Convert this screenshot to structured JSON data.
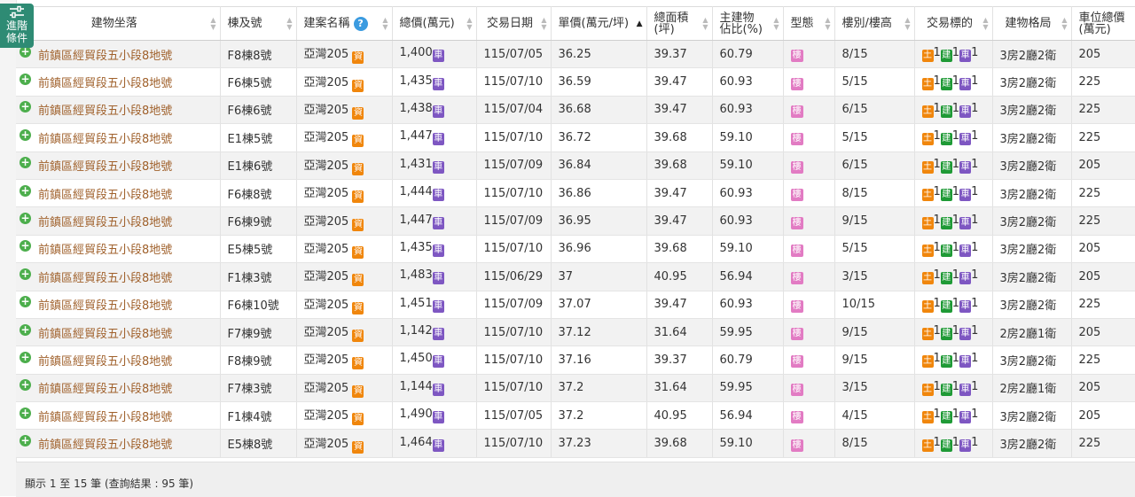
{
  "advanced_filter": {
    "label_line1": "進階",
    "label_line2": "條件",
    "icon": "sliders-icon"
  },
  "columns": [
    {
      "key": "address",
      "label": "建物坐落",
      "sort": "none"
    },
    {
      "key": "unit",
      "label": "棟及號",
      "sort": "none"
    },
    {
      "key": "project",
      "label": "建案名稱",
      "sort": "none",
      "help": "?"
    },
    {
      "key": "total_price",
      "label": "總價(萬元)",
      "sort": "none"
    },
    {
      "key": "date",
      "label": "交易日期",
      "sort": "none"
    },
    {
      "key": "unit_price",
      "label": "單價(萬元/坪)",
      "sort": "asc"
    },
    {
      "key": "area",
      "label_line1": "總面積",
      "label_line2": "(坪)",
      "sort": "none"
    },
    {
      "key": "main_ratio",
      "label_line1": "主建物",
      "label_line2": "佔比(%)",
      "sort": "none"
    },
    {
      "key": "type",
      "label": "型態",
      "sort": "none"
    },
    {
      "key": "floor",
      "label": "樓別/樓高",
      "sort": "none"
    },
    {
      "key": "target",
      "label": "交易標的",
      "sort": "none"
    },
    {
      "key": "layout",
      "label": "建物格局",
      "sort": "none"
    },
    {
      "key": "parking",
      "label_line1": "車位總價",
      "label_line2": "(萬元)",
      "sort": "none"
    }
  ],
  "badges": {
    "project": "資",
    "car": "車",
    "type": "樓",
    "land": "土",
    "build": "建"
  },
  "colors": {
    "address_text": "#a0612c",
    "badge_orange": "#f0860c",
    "badge_purple": "#7e57c2",
    "badge_green": "#1f9a36",
    "badge_pink": "#e27bc3",
    "accent_green": "#2e8b74"
  },
  "rows": [
    {
      "address": "前鎮區經貿段五小段8地號",
      "unit": "F8棟8號",
      "project": "亞灣205",
      "total_price": "1,400",
      "date": "115/07/05",
      "unit_price": "36.25",
      "area": "39.37",
      "main_ratio": "60.79",
      "floor": "8/15",
      "land": "1",
      "build": "1",
      "car": "1",
      "layout": "3房2廳2衛",
      "parking": "205"
    },
    {
      "address": "前鎮區經貿段五小段8地號",
      "unit": "F6棟5號",
      "project": "亞灣205",
      "total_price": "1,435",
      "date": "115/07/10",
      "unit_price": "36.59",
      "area": "39.47",
      "main_ratio": "60.93",
      "floor": "5/15",
      "land": "1",
      "build": "1",
      "car": "1",
      "layout": "3房2廳2衛",
      "parking": "225"
    },
    {
      "address": "前鎮區經貿段五小段8地號",
      "unit": "F6棟6號",
      "project": "亞灣205",
      "total_price": "1,438",
      "date": "115/07/04",
      "unit_price": "36.68",
      "area": "39.47",
      "main_ratio": "60.93",
      "floor": "6/15",
      "land": "1",
      "build": "1",
      "car": "1",
      "layout": "3房2廳2衛",
      "parking": "225"
    },
    {
      "address": "前鎮區經貿段五小段8地號",
      "unit": "E1棟5號",
      "project": "亞灣205",
      "total_price": "1,447",
      "date": "115/07/10",
      "unit_price": "36.72",
      "area": "39.68",
      "main_ratio": "59.10",
      "floor": "5/15",
      "land": "1",
      "build": "1",
      "car": "1",
      "layout": "3房2廳2衛",
      "parking": "225"
    },
    {
      "address": "前鎮區經貿段五小段8地號",
      "unit": "E1棟6號",
      "project": "亞灣205",
      "total_price": "1,431",
      "date": "115/07/09",
      "unit_price": "36.84",
      "area": "39.68",
      "main_ratio": "59.10",
      "floor": "6/15",
      "land": "1",
      "build": "1",
      "car": "1",
      "layout": "3房2廳2衛",
      "parking": "205"
    },
    {
      "address": "前鎮區經貿段五小段8地號",
      "unit": "F6棟8號",
      "project": "亞灣205",
      "total_price": "1,444",
      "date": "115/07/10",
      "unit_price": "36.86",
      "area": "39.47",
      "main_ratio": "60.93",
      "floor": "8/15",
      "land": "1",
      "build": "1",
      "car": "1",
      "layout": "3房2廳2衛",
      "parking": "225"
    },
    {
      "address": "前鎮區經貿段五小段8地號",
      "unit": "F6棟9號",
      "project": "亞灣205",
      "total_price": "1,447",
      "date": "115/07/09",
      "unit_price": "36.95",
      "area": "39.47",
      "main_ratio": "60.93",
      "floor": "9/15",
      "land": "1",
      "build": "1",
      "car": "1",
      "layout": "3房2廳2衛",
      "parking": "225"
    },
    {
      "address": "前鎮區經貿段五小段8地號",
      "unit": "E5棟5號",
      "project": "亞灣205",
      "total_price": "1,435",
      "date": "115/07/10",
      "unit_price": "36.96",
      "area": "39.68",
      "main_ratio": "59.10",
      "floor": "5/15",
      "land": "1",
      "build": "1",
      "car": "1",
      "layout": "3房2廳2衛",
      "parking": "205"
    },
    {
      "address": "前鎮區經貿段五小段8地號",
      "unit": "F1棟3號",
      "project": "亞灣205",
      "total_price": "1,483",
      "date": "115/06/29",
      "unit_price": "37",
      "area": "40.95",
      "main_ratio": "56.94",
      "floor": "3/15",
      "land": "1",
      "build": "1",
      "car": "1",
      "layout": "3房2廳2衛",
      "parking": "205"
    },
    {
      "address": "前鎮區經貿段五小段8地號",
      "unit": "F6棟10號",
      "project": "亞灣205",
      "total_price": "1,451",
      "date": "115/07/09",
      "unit_price": "37.07",
      "area": "39.47",
      "main_ratio": "60.93",
      "floor": "10/15",
      "land": "1",
      "build": "1",
      "car": "1",
      "layout": "3房2廳2衛",
      "parking": "225"
    },
    {
      "address": "前鎮區經貿段五小段8地號",
      "unit": "F7棟9號",
      "project": "亞灣205",
      "total_price": "1,142",
      "date": "115/07/10",
      "unit_price": "37.12",
      "area": "31.64",
      "main_ratio": "59.95",
      "floor": "9/15",
      "land": "1",
      "build": "1",
      "car": "1",
      "layout": "2房2廳1衛",
      "parking": "205"
    },
    {
      "address": "前鎮區經貿段五小段8地號",
      "unit": "F8棟9號",
      "project": "亞灣205",
      "total_price": "1,450",
      "date": "115/07/10",
      "unit_price": "37.16",
      "area": "39.37",
      "main_ratio": "60.79",
      "floor": "9/15",
      "land": "1",
      "build": "1",
      "car": "1",
      "layout": "3房2廳2衛",
      "parking": "225"
    },
    {
      "address": "前鎮區經貿段五小段8地號",
      "unit": "F7棟3號",
      "project": "亞灣205",
      "total_price": "1,144",
      "date": "115/07/10",
      "unit_price": "37.2",
      "area": "31.64",
      "main_ratio": "59.95",
      "floor": "3/15",
      "land": "1",
      "build": "1",
      "car": "1",
      "layout": "2房2廳1衛",
      "parking": "205"
    },
    {
      "address": "前鎮區經貿段五小段8地號",
      "unit": "F1棟4號",
      "project": "亞灣205",
      "total_price": "1,490",
      "date": "115/07/05",
      "unit_price": "37.2",
      "area": "40.95",
      "main_ratio": "56.94",
      "floor": "4/15",
      "land": "1",
      "build": "1",
      "car": "1",
      "layout": "3房2廳2衛",
      "parking": "205"
    },
    {
      "address": "前鎮區經貿段五小段8地號",
      "unit": "E5棟8號",
      "project": "亞灣205",
      "total_price": "1,464",
      "date": "115/07/10",
      "unit_price": "37.23",
      "area": "39.68",
      "main_ratio": "59.10",
      "floor": "8/15",
      "land": "1",
      "build": "1",
      "car": "1",
      "layout": "3房2廳2衛",
      "parking": "225"
    }
  ],
  "footer": {
    "summary": "顯示 1 至 15 筆 (查詢結果 : 95 筆)"
  }
}
